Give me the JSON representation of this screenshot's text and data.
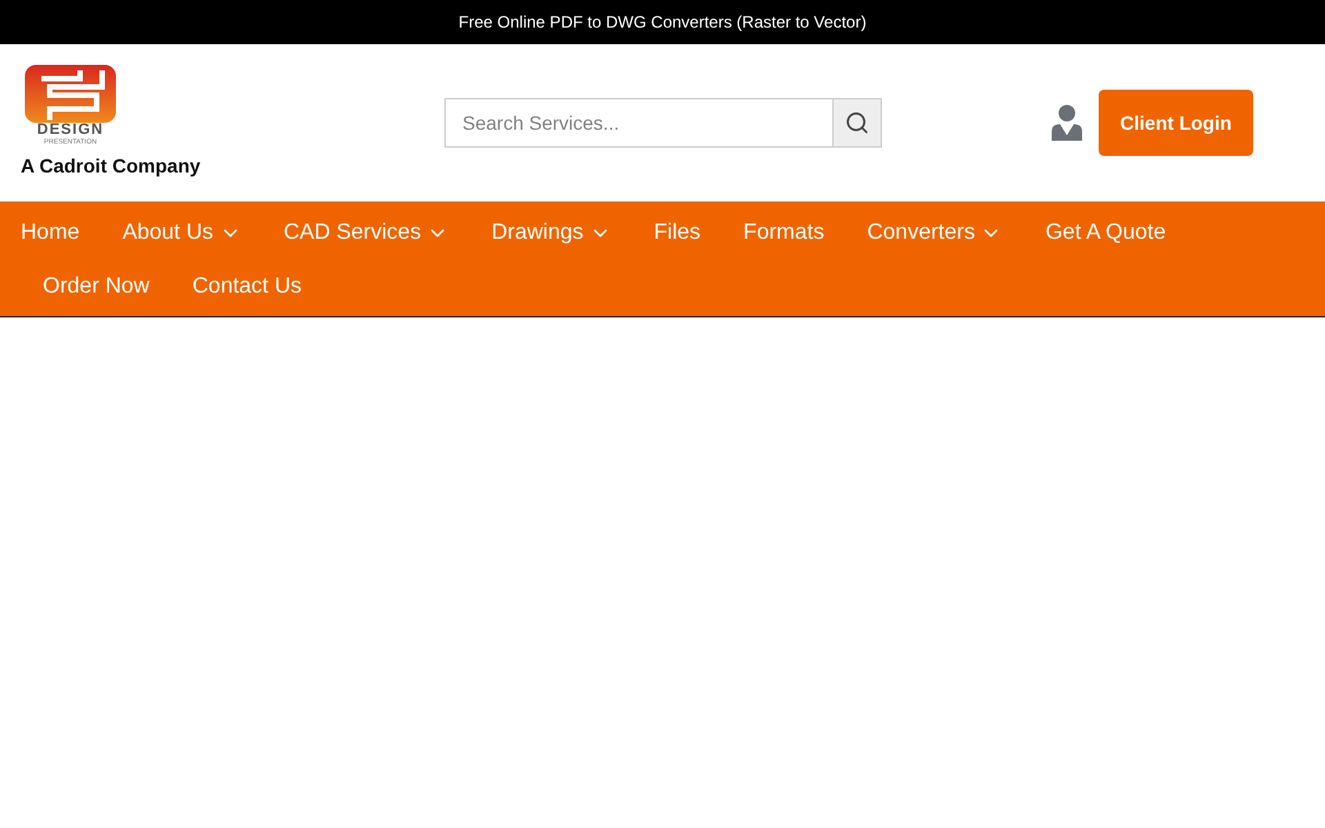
{
  "top_bar": {
    "text": "Free Online PDF to DWG Converters (Raster to Vector)"
  },
  "logo": {
    "word": "DESIGN",
    "subword": "PRESENTATION",
    "tagline": "A Cadroit Company"
  },
  "search": {
    "placeholder": "Search Services..."
  },
  "client_login": {
    "label": "Client Login"
  },
  "nav": [
    {
      "label": "Home",
      "dropdown": false
    },
    {
      "label": "About Us",
      "dropdown": true
    },
    {
      "label": "CAD Services",
      "dropdown": true
    },
    {
      "label": "Drawings",
      "dropdown": true
    },
    {
      "label": "Files",
      "dropdown": false
    },
    {
      "label": "Formats",
      "dropdown": false
    },
    {
      "label": "Converters",
      "dropdown": true
    },
    {
      "label": "Get A Quote",
      "dropdown": false
    },
    {
      "label": "Order Now",
      "dropdown": false
    },
    {
      "label": "Contact Us",
      "dropdown": false
    }
  ]
}
